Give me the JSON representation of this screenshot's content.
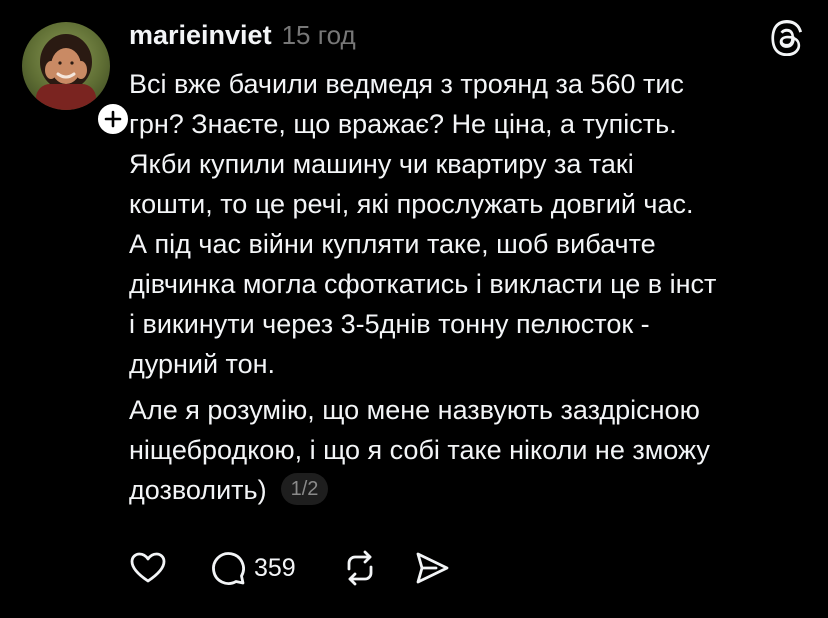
{
  "post": {
    "author": {
      "username": "marieinviet",
      "avatar_icon": "avatar-photo",
      "follow_icon": "plus-icon"
    },
    "timestamp": "15 год",
    "app_logo": "threads-logo",
    "text_lines": [
      "Всі вже бачили ведмедя з троянд за 560 тис",
      "грн? Знаєте, що вражає? Не ціна, а тупість.",
      "Якби купили машину чи квартиру за такі",
      "кошти, то це речі, які прослужать довгий час.",
      "А під час війни купляти таке, шоб вибачте",
      "дівчинка могла сфоткатись і викласти це в інст",
      "і викинути через 3-5днів тонну пелюсток -",
      "дурний тон."
    ],
    "text_lines_2": [
      "Але я розумію, що мене назвують заздрісною",
      "ніщебродкою, і що я собі таке ніколи не зможу",
      "дозволить)"
    ],
    "page_indicator": "1/2",
    "actions": {
      "like_icon": "heart-icon",
      "reply_icon": "comment-icon",
      "reply_count": "359",
      "repost_icon": "repost-icon",
      "share_icon": "send-icon"
    }
  },
  "colors": {
    "background": "#000000",
    "text": "#f3f5f7",
    "muted": "#777777",
    "badge_bg": "#1e1e1e"
  }
}
